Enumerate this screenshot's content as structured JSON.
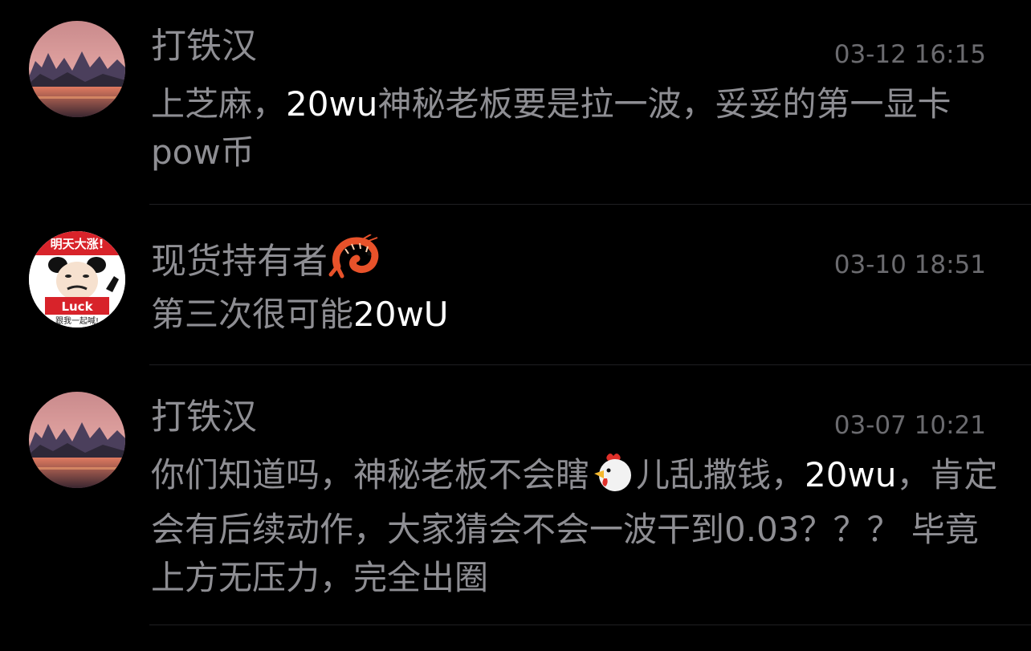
{
  "comments": [
    {
      "username": "打铁汉",
      "timestamp": "03-12 16:15",
      "text_parts": [
        "上芝麻，",
        "20wu",
        "神秘老板要是拉一波，妥妥的第一显卡pow币"
      ],
      "avatar": "sunset-landscape"
    },
    {
      "username": "现货持有者",
      "username_emoji": "shrimp-icon",
      "timestamp": "03-10 18:51",
      "text_parts": [
        "第三次很可能",
        "20wU"
      ],
      "avatar": {
        "type": "meme-panda",
        "top_text": "明天大涨!",
        "badge_text": "Luck",
        "bottom_text": "跟我一起喊!"
      }
    },
    {
      "username": "打铁汉",
      "timestamp": "03-07 10:21",
      "text_parts": [
        "你们知道吗，神秘老板不会瞎",
        "儿乱撒钱，",
        "20wu",
        "，肯定会有后续动作，大家猜会不会一波干到0.03？？？ 毕竟上方无压力，完全出圈"
      ],
      "inline_emoji": "chicken-icon",
      "avatar": "sunset-landscape"
    }
  ],
  "colors": {
    "background": "#000000",
    "text": "#8e8e93",
    "highlight_text": "#ffffff",
    "timestamp": "#6b6b6f",
    "divider": "#1f1f22"
  }
}
